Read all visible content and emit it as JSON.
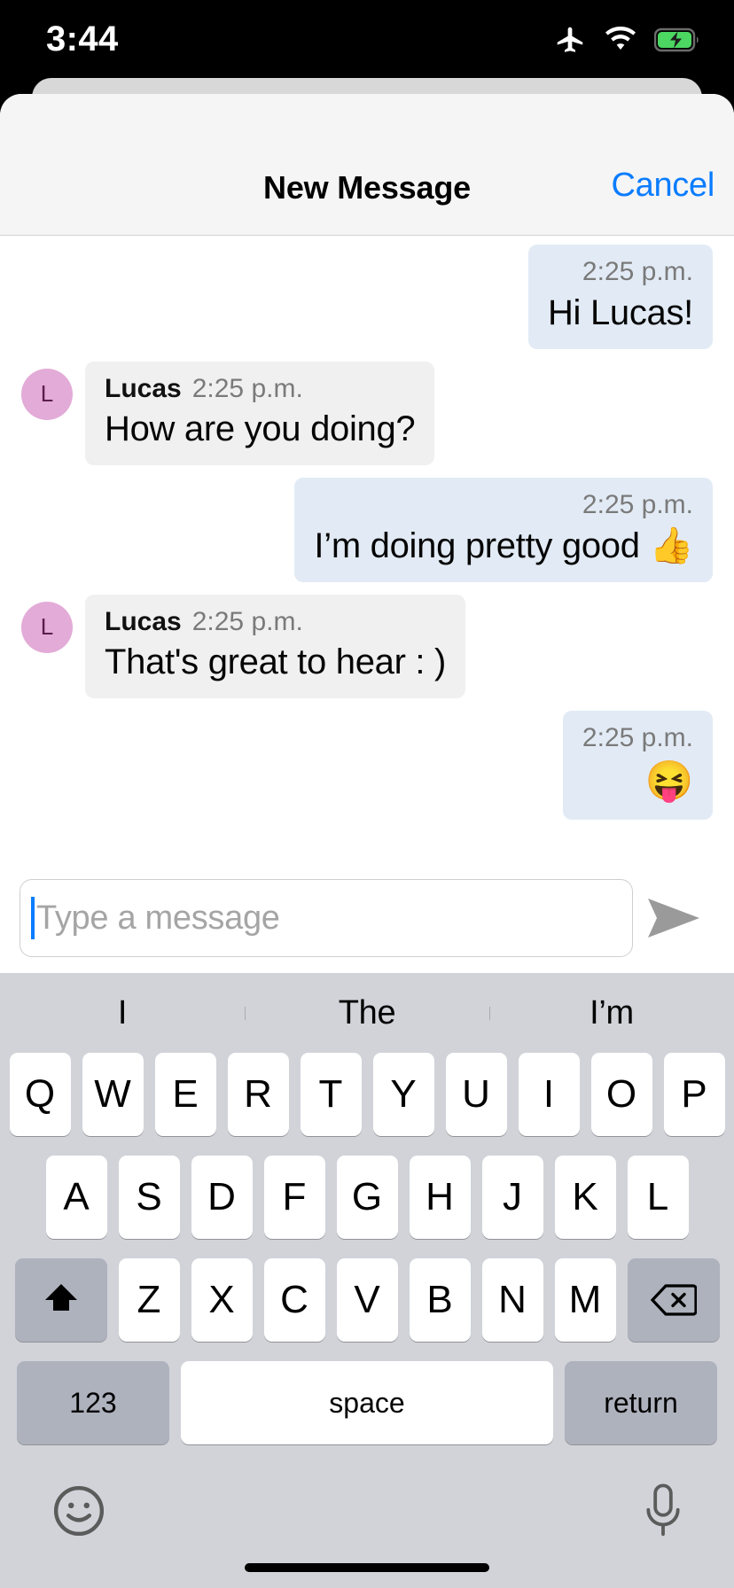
{
  "status_bar": {
    "time": "3:44",
    "icons": [
      "airplane-mode-icon",
      "wifi-icon",
      "battery-charging-icon"
    ],
    "battery_color": "#4cd662"
  },
  "sheet": {
    "title": "New Message",
    "cancel_label": "Cancel",
    "cancel_color": "#0a7cff"
  },
  "conversation": {
    "messages": [
      {
        "direction": "out",
        "sender": "",
        "time": "2:25 p.m.",
        "text": "Hi Lucas!"
      },
      {
        "direction": "in",
        "sender": "Lucas",
        "time": "2:25 p.m.",
        "text": "How are you doing?",
        "avatar_initial": "L"
      },
      {
        "direction": "out",
        "sender": "",
        "time": "2:25 p.m.",
        "text": "I’m doing pretty good 👍"
      },
      {
        "direction": "in",
        "sender": "Lucas",
        "time": "2:25 p.m.",
        "text": "That's great to hear : )",
        "avatar_initial": "L"
      },
      {
        "direction": "out",
        "sender": "",
        "time": "2:25 p.m.",
        "text": "😝"
      }
    ],
    "bubble_out_color": "#e2ebf5",
    "bubble_in_color": "#f0f0f0",
    "avatar_color": "#e3abd7"
  },
  "composer": {
    "placeholder": "Type a message",
    "value": "",
    "send_icon": "send-arrow-icon"
  },
  "keyboard": {
    "predictions": [
      "I",
      "The",
      "I’m"
    ],
    "row1": [
      "Q",
      "W",
      "E",
      "R",
      "T",
      "Y",
      "U",
      "I",
      "O",
      "P"
    ],
    "row2": [
      "A",
      "S",
      "D",
      "F",
      "G",
      "H",
      "J",
      "K",
      "L"
    ],
    "row3": [
      "Z",
      "X",
      "C",
      "V",
      "B",
      "N",
      "M"
    ],
    "shift_label": "shift-icon",
    "backspace_label": "backspace-icon",
    "numbers_label": "123",
    "space_label": "space",
    "return_label": "return",
    "emoji_label": "emoji-icon",
    "mic_label": "microphone-icon"
  }
}
